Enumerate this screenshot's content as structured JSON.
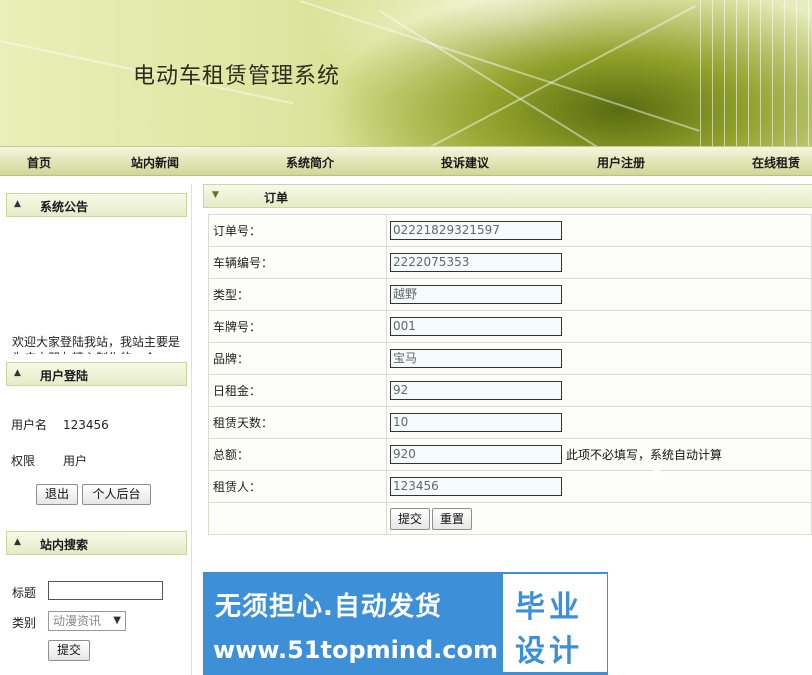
{
  "app": {
    "title": "电动车租赁管理系统"
  },
  "nav": [
    {
      "label": "首页"
    },
    {
      "label": "站内新闻"
    },
    {
      "label": "系统简介"
    },
    {
      "label": "投诉建议"
    },
    {
      "label": "用户注册"
    },
    {
      "label": "在线租赁"
    }
  ],
  "sidebar": {
    "announcement": {
      "title": "系统公告",
      "text": "欢迎大家登陆我站，我站主要是为广大朋友精心制作的一个"
    },
    "login": {
      "title": "用户登陆",
      "username_label": "用户名",
      "username": "123456",
      "role_label": "权限",
      "role": "用户",
      "logout_label": "退出",
      "profile_label": "个人后台"
    },
    "search": {
      "title": "站内搜索",
      "title_label": "标题",
      "title_value": "",
      "category_label": "类别",
      "category_value": "动漫资讯",
      "submit_label": "提交"
    }
  },
  "main": {
    "section_title": "订单",
    "fields": [
      {
        "label": "订单号：",
        "value": "02221829321597"
      },
      {
        "label": "车辆编号：",
        "value": "2222075353"
      },
      {
        "label": "类型：",
        "value": "越野"
      },
      {
        "label": "车牌号：",
        "value": "001"
      },
      {
        "label": "品牌：",
        "value": "宝马"
      },
      {
        "label": "日租金：",
        "value": "92"
      },
      {
        "label": "租赁天数：",
        "value": "10"
      },
      {
        "label": "总额：",
        "value": "920",
        "hint": "此项不必填写，系统自动计算"
      },
      {
        "label": "租赁人：",
        "value": "123456"
      }
    ],
    "submit_label": "提交",
    "reset_label": "重置"
  },
  "ad": {
    "line1": "无须担心.自动发货",
    "line2": "www.51topmind.com",
    "badge1": "毕业",
    "badge2": "设计"
  }
}
